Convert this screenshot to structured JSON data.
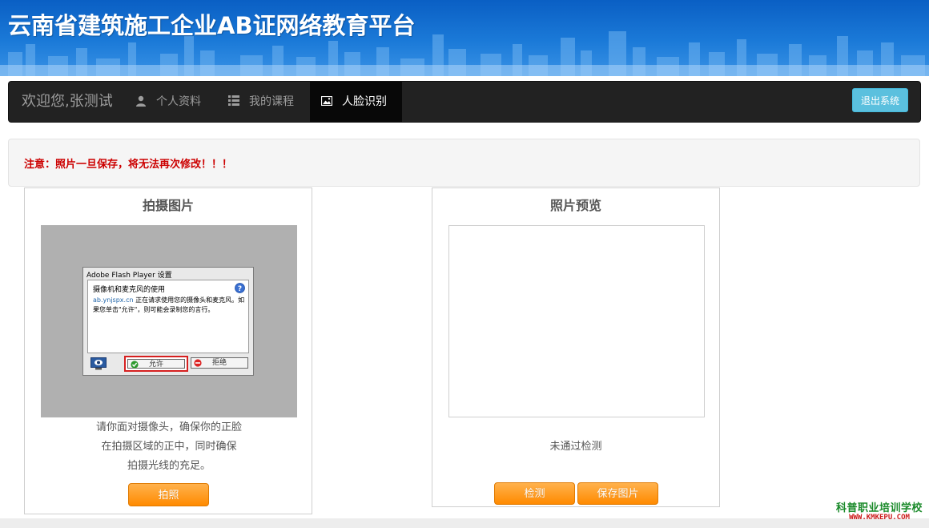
{
  "banner": {
    "title": "云南省建筑施工企业AB证网络教育平台"
  },
  "navbar": {
    "welcome": "欢迎您,张测试",
    "items": [
      {
        "label": "个人资料",
        "icon": "user-icon"
      },
      {
        "label": "我的课程",
        "icon": "list-icon"
      },
      {
        "label": "人脸识别",
        "icon": "picture-icon",
        "active": true
      }
    ],
    "logout_label": "退出系统"
  },
  "notice": {
    "text": "注意：照片一旦保存，将无法再次修改！！！"
  },
  "capture_panel": {
    "title": "拍摄图片",
    "instructions": [
      "请你面对摄像头，确保你的正脸",
      "在拍摄区域的正中，同时确保",
      "拍摄光线的充足。"
    ],
    "shoot_label": "拍照",
    "flash_dialog": {
      "title": "Adobe Flash Player 设置",
      "heading": "摄像机和麦克风的使用",
      "domain": "ab.ynjspx.cn",
      "message": " 正在请求使用您的摄像头和麦克风。如果您单击\"允许\"，则可能会录制您的言行。",
      "allow_label": "允许",
      "deny_label": "拒绝"
    }
  },
  "preview_panel": {
    "title": "照片预览",
    "status": "未通过检测",
    "detect_label": "检测",
    "save_label": "保存图片"
  },
  "watermark": {
    "name": "科普职业培训学校",
    "url": "WWW.KMKEPU.COM"
  },
  "colors": {
    "banner_blue": "#1b7ad8",
    "navbar_bg": "#222222",
    "logout_bg": "#5bc0de",
    "notice_red": "#cc0000",
    "button_orange": "#ff8a00"
  }
}
